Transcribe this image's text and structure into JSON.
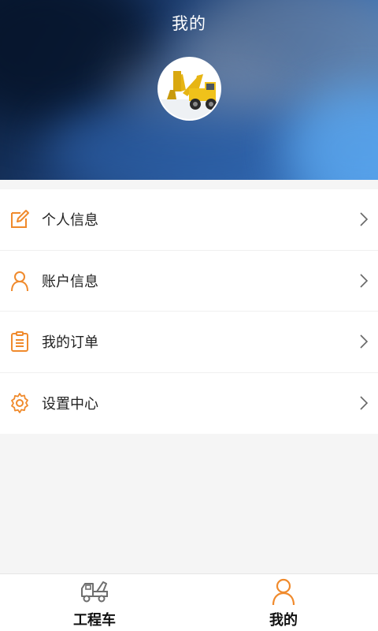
{
  "header": {
    "title": "我的"
  },
  "menu": {
    "items": [
      {
        "label": "个人信息",
        "icon": "edit-icon"
      },
      {
        "label": "账户信息",
        "icon": "user-icon"
      },
      {
        "label": "我的订单",
        "icon": "clipboard-icon"
      },
      {
        "label": "设置中心",
        "icon": "gear-icon"
      }
    ]
  },
  "tabbar": {
    "tabs": [
      {
        "label": "工程车",
        "icon": "truck-icon",
        "active": false
      },
      {
        "label": "我的",
        "icon": "user-icon",
        "active": true
      }
    ]
  },
  "colors": {
    "accent": "#f08a2c",
    "inactive_icon": "#6e6e6e"
  }
}
